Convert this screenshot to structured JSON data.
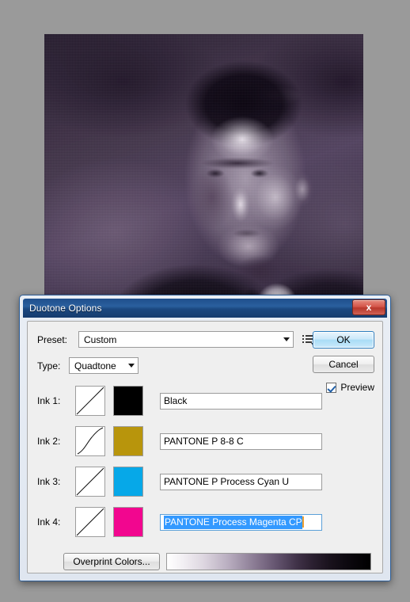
{
  "dialog": {
    "title": "Duotone Options",
    "close_label": "x",
    "preset": {
      "label": "Preset:",
      "value": "Custom",
      "menu_icon": "preset-options-icon"
    },
    "type": {
      "label": "Type:",
      "value": "Quadtone"
    },
    "inks": [
      {
        "label": "Ink 1:",
        "name": "Black",
        "color": "#000000",
        "curve": "linear",
        "selected": false
      },
      {
        "label": "Ink 2:",
        "name": "PANTONE P 8-8 C",
        "color": "#b8950c",
        "curve": "s-curve",
        "selected": false
      },
      {
        "label": "Ink 3:",
        "name": "PANTONE P Process Cyan U",
        "color": "#06a8e8",
        "curve": "linear",
        "selected": false
      },
      {
        "label": "Ink 4:",
        "name": "PANTONE Process Magenta CP",
        "color": "#f2068f",
        "curve": "linear",
        "selected": true
      }
    ],
    "overprint_button": "Overprint Colors...",
    "ok_button": "OK",
    "cancel_button": "Cancel",
    "preview": {
      "label": "Preview",
      "checked": true
    },
    "gradient_bar": {
      "from": "#ffffff",
      "to": "#000000",
      "midtone": "#8e7f97"
    }
  },
  "canvas": {
    "background_color": "#9a9a9a",
    "image_description": "duotone-tinted vintage portrait photograph"
  }
}
